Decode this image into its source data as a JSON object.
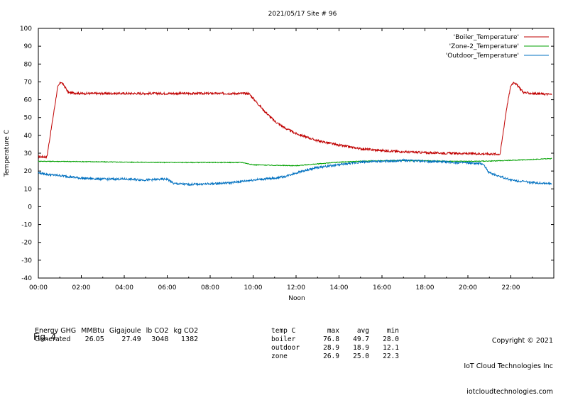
{
  "chart_data": {
    "type": "line",
    "title": "2021/05/17  Site # 96",
    "xlabel": "Noon",
    "ylabel": "Temperature C",
    "xlim": [
      0,
      24
    ],
    "ylim": [
      -40,
      100
    ],
    "yticks": [
      -40,
      -30,
      -20,
      -10,
      0,
      10,
      20,
      30,
      40,
      50,
      60,
      70,
      80,
      90,
      100
    ],
    "xticks": [
      {
        "h": 0,
        "label": "00:00"
      },
      {
        "h": 2,
        "label": "02:00"
      },
      {
        "h": 4,
        "label": "04:00"
      },
      {
        "h": 6,
        "label": "06:00"
      },
      {
        "h": 8,
        "label": "08:00"
      },
      {
        "h": 10,
        "label": "10:00"
      },
      {
        "h": 12,
        "label": "12:00"
      },
      {
        "h": 14,
        "label": "14:00"
      },
      {
        "h": 16,
        "label": "16:00"
      },
      {
        "h": 18,
        "label": "18:00"
      },
      {
        "h": 20,
        "label": "20:00"
      },
      {
        "h": 22,
        "label": "22:00"
      }
    ],
    "legend_position": "top-right",
    "series": [
      {
        "name": "'Boiler_Temperature'",
        "color": "#c00000",
        "x": [
          0,
          0.4,
          0.9,
          1.05,
          1.2,
          1.4,
          2,
          3,
          4,
          5,
          6,
          7,
          8,
          9,
          9.8,
          10.5,
          11,
          11.5,
          12,
          13,
          14,
          15,
          16,
          17,
          18,
          19,
          20,
          21,
          21.5,
          21.8,
          22.0,
          22.15,
          22.3,
          22.6,
          23,
          23.9
        ],
        "y": [
          28,
          28,
          67,
          70,
          68,
          64,
          63.5,
          63.5,
          63.5,
          63.5,
          63.5,
          63.5,
          63.5,
          63.5,
          63.5,
          54,
          48,
          44,
          41,
          37,
          34.5,
          32.5,
          31.5,
          30.8,
          30.3,
          30,
          29.8,
          29.6,
          29.5,
          55,
          68,
          70,
          68,
          64,
          63.5,
          63
        ]
      },
      {
        "name": "'Zone-2_Temperature'",
        "color": "#00a000",
        "x": [
          0,
          2,
          4,
          6,
          8,
          9.5,
          10,
          11,
          12,
          13,
          14,
          15,
          16,
          17,
          18,
          19,
          20,
          21,
          22,
          23,
          23.9
        ],
        "y": [
          25.5,
          25.3,
          25,
          24.8,
          24.8,
          24.8,
          23.5,
          23.2,
          23,
          24,
          25,
          25.5,
          25.8,
          25.8,
          25.8,
          25.5,
          25.5,
          25.6,
          26,
          26.5,
          27
        ]
      },
      {
        "name": "'Outdoor_Temperature'",
        "color": "#0070c0",
        "x": [
          0,
          0.5,
          1,
          2,
          3,
          4,
          5,
          6,
          6.3,
          7,
          8,
          9,
          10,
          11,
          11.5,
          12,
          13,
          14,
          15,
          16,
          16.5,
          17,
          18,
          19,
          20,
          20.7,
          21,
          21.5,
          22,
          23,
          23.9
        ],
        "y": [
          19,
          18,
          17.5,
          16,
          15.5,
          15.5,
          15,
          15.5,
          13,
          12.5,
          12.8,
          13.5,
          15,
          16,
          17,
          19,
          22,
          23.5,
          25,
          25.5,
          25.5,
          26,
          25.5,
          25,
          24.5,
          24,
          19,
          17,
          15,
          13.5,
          13
        ]
      }
    ]
  },
  "energy_table": {
    "header": [
      "Energy GHG",
      "MMBtu",
      "Gigajoule",
      "lb CO2",
      "kg CO2"
    ],
    "row": [
      "Generated",
      "26.05",
      "27.49",
      "3048",
      "1382"
    ]
  },
  "temp_table": {
    "header": [
      "temp C",
      "max",
      "avg",
      "min"
    ],
    "rows": [
      [
        "boiler",
        "76.8",
        "49.7",
        "28.0"
      ],
      [
        "outdoor",
        "28.9",
        "18.9",
        "12.1"
      ],
      [
        "zone",
        "26.9",
        "25.0",
        "22.3"
      ]
    ]
  },
  "copyright": {
    "line1": "Copyright © 2021",
    "line2": "IoT Cloud Technologies Inc",
    "line3": "iotcloudtechnologies.com"
  },
  "figure_label": "Fig. 4"
}
